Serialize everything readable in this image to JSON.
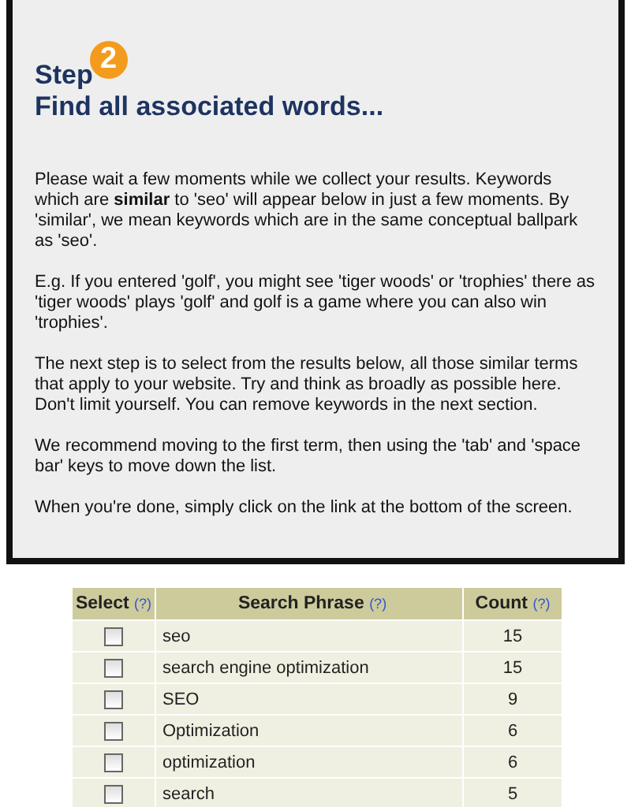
{
  "step": {
    "label": "Step",
    "number": "2",
    "title": "Find all associated words..."
  },
  "paragraphs": [
    "Please wait a few moments while we collect your results. Keywords which are **similar** to 'seo' will appear below in just a few moments. By 'similar', we mean keywords which are in the same conceptual ballpark as 'seo'.",
    "E.g. If you entered 'golf', you might see 'tiger woods' or 'trophies' there as 'tiger woods' plays 'golf' and golf is a game where you can also win 'trophies'.",
    "The next step is to select from the results below, all those similar terms that apply to your website. Try and think as broadly as possible here. Don't limit yourself. You can remove keywords in the next section.",
    "We recommend moving to the first term, then using the 'tab' and 'space bar' keys to move down the list.",
    "When you're done, simply click on the link at the bottom of the screen."
  ],
  "table": {
    "columns": [
      {
        "label": "Select",
        "help": "(?)"
      },
      {
        "label": "Search Phrase",
        "help": "(?)"
      },
      {
        "label": "Count",
        "help": "(?)"
      }
    ],
    "rows": [
      {
        "phrase": "seo",
        "count": "15",
        "checked": false
      },
      {
        "phrase": "search engine optimization",
        "count": "15",
        "checked": false
      },
      {
        "phrase": "SEO",
        "count": "9",
        "checked": false
      },
      {
        "phrase": "Optimization",
        "count": "6",
        "checked": false
      },
      {
        "phrase": "optimization",
        "count": "6",
        "checked": false
      },
      {
        "phrase": "search",
        "count": "5",
        "checked": false
      }
    ]
  }
}
